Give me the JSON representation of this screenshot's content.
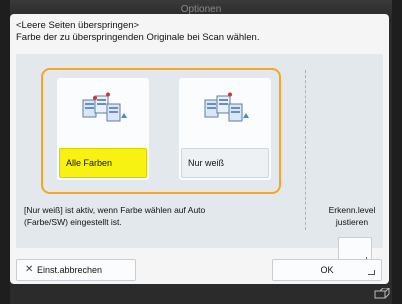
{
  "window": {
    "title": "Optionen"
  },
  "dialog": {
    "heading_line1": "<Leere Seiten überspringen>",
    "heading_line2": "Farbe der zu überspringenden Originale bei Scan wählen."
  },
  "options": [
    {
      "label": "Alle Farben",
      "selected": true,
      "icon": "color-documents-icon"
    },
    {
      "label": "Nur weiß",
      "selected": false,
      "icon": "white-documents-icon"
    }
  ],
  "note": {
    "line1": "[Nur weiß] ist aktiv, wenn Farbe wählen auf Auto",
    "line2": "(Farbe/SW) eingestellt ist."
  },
  "adjust": {
    "line1": "Erkenn.level",
    "line2": "justieren"
  },
  "buttons": {
    "cancel": "Einst.abbrechen",
    "ok": "OK"
  },
  "colors": {
    "selected": "#f8f212",
    "highlight_border": "#f5a623",
    "panel": "#e3e8ec"
  },
  "status_bar": {
    "icon": "device-status-icon"
  }
}
